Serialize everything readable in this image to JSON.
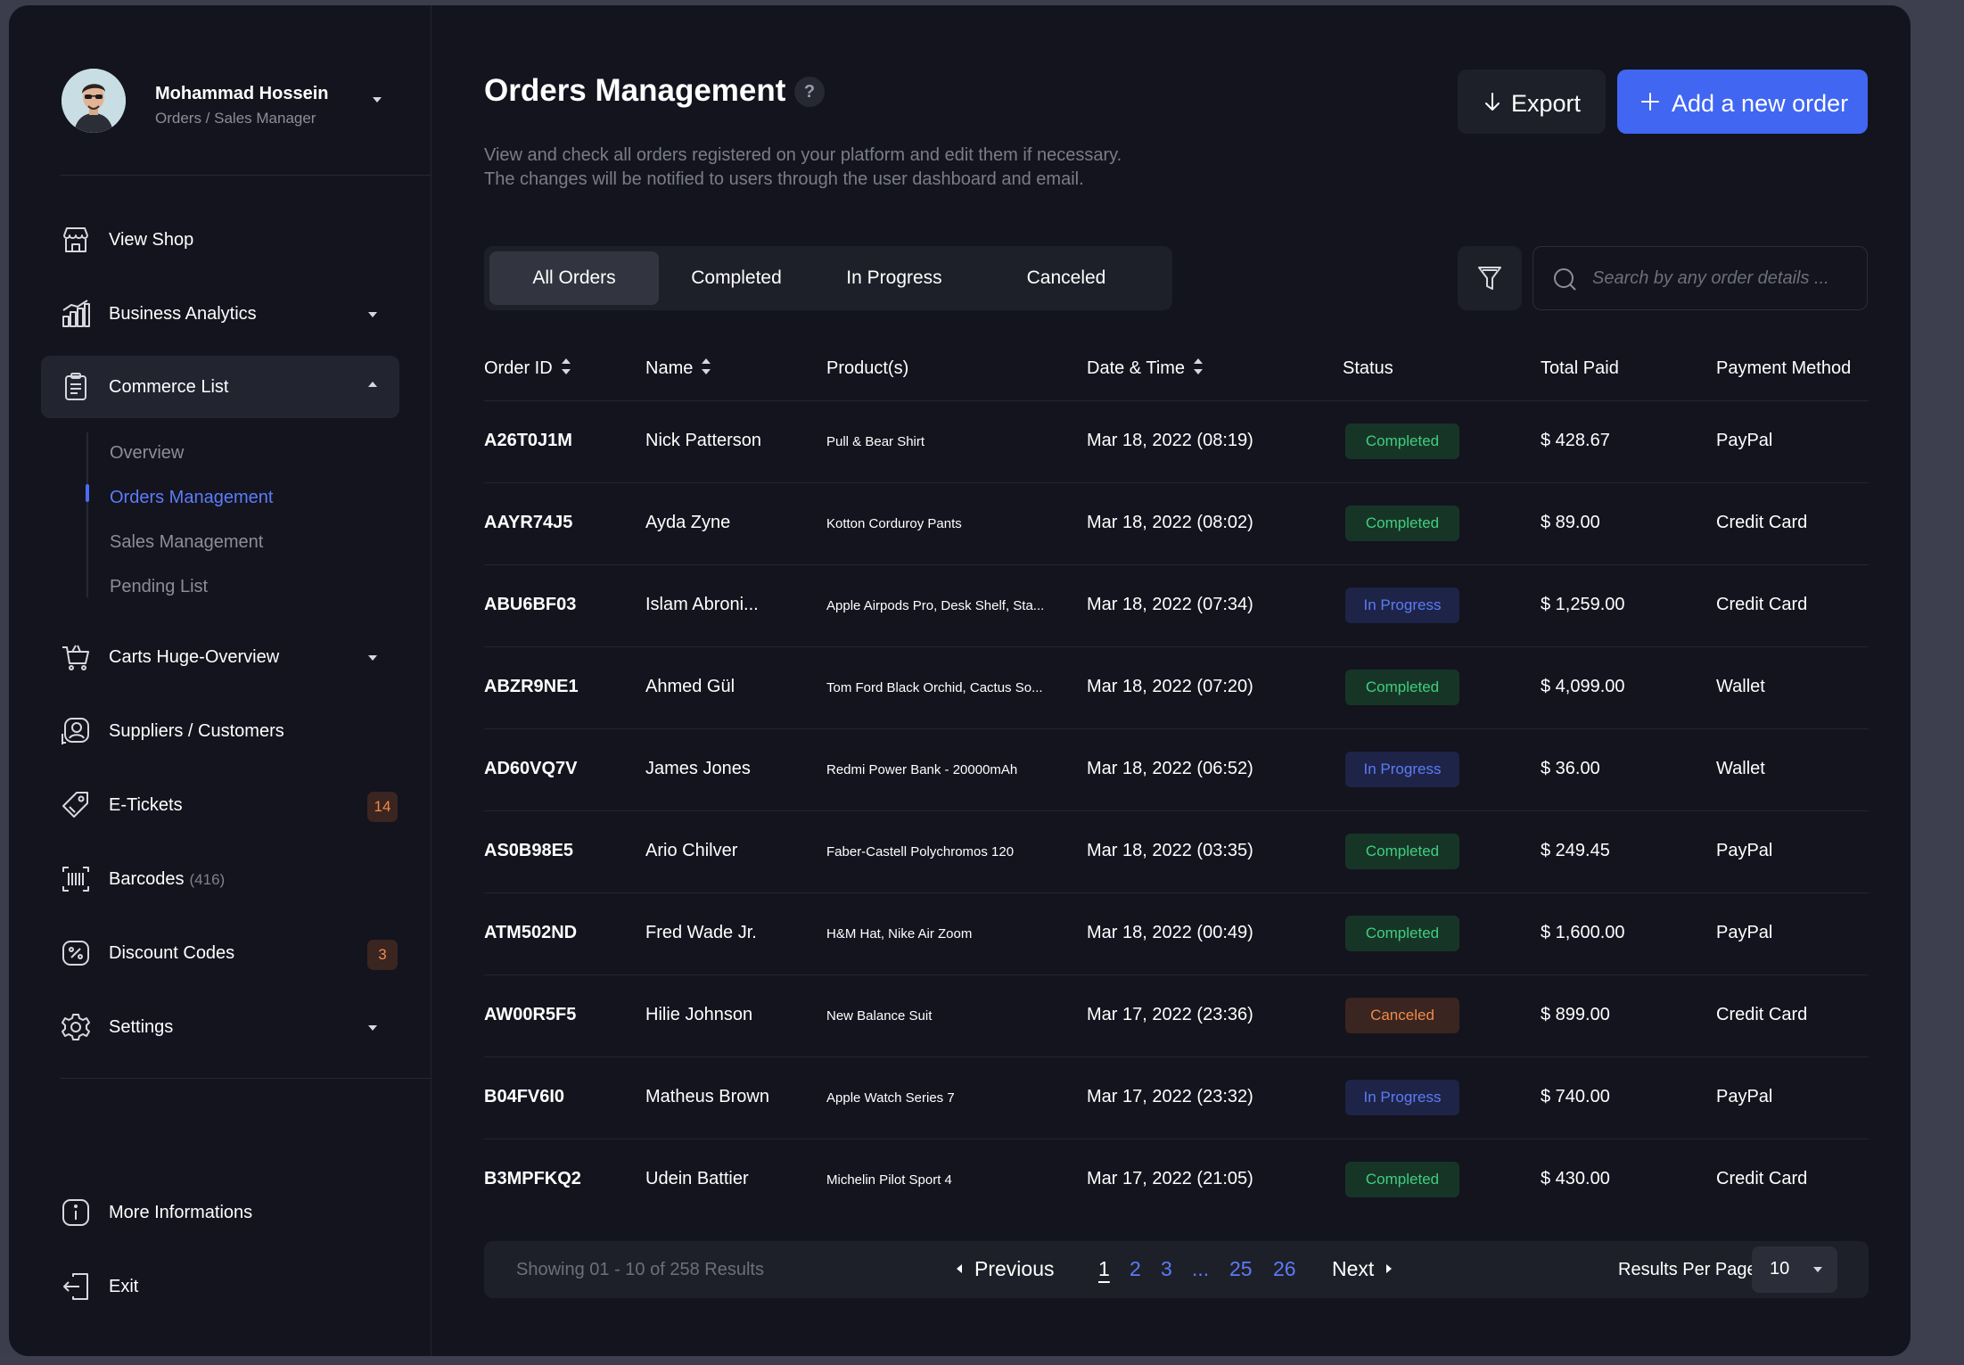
{
  "profile": {
    "name": "Mohammad Hossein",
    "role": "Orders / Sales Manager"
  },
  "sidebar": {
    "items": [
      {
        "label": "View Shop",
        "icon": "store-icon"
      },
      {
        "label": "Business Analytics",
        "icon": "chart-icon"
      },
      {
        "label": "Commerce List",
        "icon": "clipboard-icon"
      },
      {
        "label": "Carts Huge-Overview",
        "icon": "cart-icon"
      },
      {
        "label": "Suppliers / Customers",
        "icon": "user-icon"
      },
      {
        "label": "E-Tickets",
        "icon": "ticket-icon",
        "badge": "14"
      },
      {
        "label": "Barcodes",
        "icon": "barcode-icon",
        "count": "(416)"
      },
      {
        "label": "Discount Codes",
        "icon": "discount-icon",
        "badge": "3"
      },
      {
        "label": "Settings",
        "icon": "gear-icon"
      }
    ],
    "subitems": [
      "Overview",
      "Orders Management",
      "Sales Management",
      "Pending List"
    ],
    "bottom": [
      {
        "label": "More Informations",
        "icon": "info-icon"
      },
      {
        "label": "Exit",
        "icon": "exit-icon"
      }
    ]
  },
  "header": {
    "title": "Orders Management",
    "help": "?",
    "description_line1": "View and check all orders registered on your platform and edit them if necessary.",
    "description_line2": "The changes will be notified to users through the user dashboard and email.",
    "export_label": "Export",
    "add_label": "Add a new order"
  },
  "tabs": [
    "All Orders",
    "Completed",
    "In Progress",
    "Canceled"
  ],
  "search": {
    "placeholder": "Search by any order details ..."
  },
  "table": {
    "columns": [
      "Order ID",
      "Name",
      "Product(s)",
      "Date & Time",
      "Status",
      "Total Paid",
      "Payment Method"
    ],
    "rows": [
      {
        "id": "A26T0J1M",
        "name": "Nick Patterson",
        "products": "Pull & Bear Shirt",
        "date": "Mar 18, 2022 (08:19)",
        "status": "Completed",
        "total": "$ 428.67",
        "payment": "PayPal"
      },
      {
        "id": "AAYR74J5",
        "name": "Ayda Zyne",
        "products": "Kotton Corduroy Pants",
        "date": "Mar 18, 2022 (08:02)",
        "status": "Completed",
        "total": "$ 89.00",
        "payment": "Credit Card"
      },
      {
        "id": "ABU6BF03",
        "name": "Islam Abroni...",
        "products": "Apple Airpods Pro, Desk Shelf, Sta...",
        "date": "Mar 18, 2022 (07:34)",
        "status": "In Progress",
        "total": "$ 1,259.00",
        "payment": "Credit Card"
      },
      {
        "id": "ABZR9NE1",
        "name": "Ahmed Gül",
        "products": "Tom Ford Black Orchid, Cactus So...",
        "date": "Mar 18, 2022 (07:20)",
        "status": "Completed",
        "total": "$ 4,099.00",
        "payment": "Wallet"
      },
      {
        "id": "AD60VQ7V",
        "name": "James Jones",
        "products": "Redmi Power Bank - 20000mAh",
        "date": "Mar 18, 2022 (06:52)",
        "status": "In Progress",
        "total": "$ 36.00",
        "payment": "Wallet"
      },
      {
        "id": "AS0B98E5",
        "name": "Ario Chilver",
        "products": "Faber-Castell Polychromos 120",
        "date": "Mar 18, 2022 (03:35)",
        "status": "Completed",
        "total": "$ 249.45",
        "payment": "PayPal"
      },
      {
        "id": "ATM502ND",
        "name": "Fred Wade Jr.",
        "products": "H&M Hat, Nike Air Zoom",
        "date": "Mar 18, 2022 (00:49)",
        "status": "Completed",
        "total": "$ 1,600.00",
        "payment": "PayPal"
      },
      {
        "id": "AW00R5F5",
        "name": "Hilie Johnson",
        "products": "New Balance Suit",
        "date": "Mar 17, 2022 (23:36)",
        "status": "Canceled",
        "total": "$ 899.00",
        "payment": "Credit Card"
      },
      {
        "id": "B04FV6I0",
        "name": "Matheus Brown",
        "products": "Apple Watch Series 7",
        "date": "Mar 17, 2022 (23:32)",
        "status": "In Progress",
        "total": "$ 740.00",
        "payment": "PayPal"
      },
      {
        "id": "B3MPFKQ2",
        "name": "Udein Battier",
        "products": "Michelin Pilot Sport 4",
        "date": "Mar 17, 2022 (21:05)",
        "status": "Completed",
        "total": "$ 430.00",
        "payment": "Credit Card"
      }
    ]
  },
  "pagination": {
    "showing": "Showing 01 - 10 of 258 Results",
    "previous": "Previous",
    "next": "Next",
    "pages": [
      "1",
      "2",
      "3",
      "...",
      "25",
      "26"
    ],
    "current": "1",
    "per_page_label": "Results Per Page:",
    "per_page_value": "10"
  },
  "colors": {
    "accent": "#4066f2",
    "completed": "#3fcf7f",
    "in_progress": "#5b7bf7",
    "canceled": "#f08a4b",
    "background": "#13141e"
  }
}
